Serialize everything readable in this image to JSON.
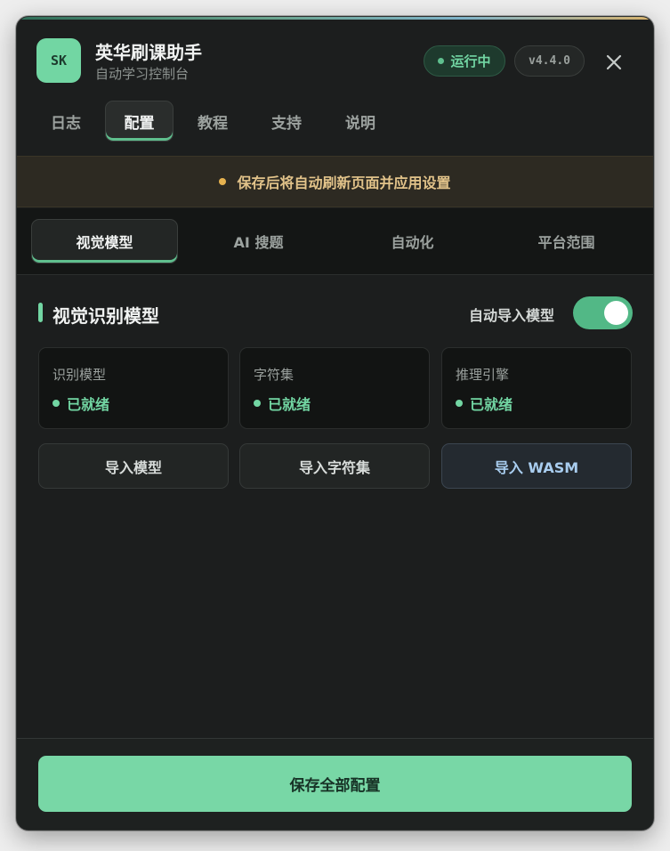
{
  "header": {
    "logo_text": "SK",
    "title": "英华刷课助手",
    "subtitle": "自动学习控制台",
    "status": "运行中",
    "version": "v4.4.0",
    "close_icon": "close-icon"
  },
  "main_tabs": [
    {
      "label": "日志"
    },
    {
      "label": "配置",
      "active": true
    },
    {
      "label": "教程"
    },
    {
      "label": "支持"
    },
    {
      "label": "说明"
    }
  ],
  "banner": {
    "text": "保存后将自动刷新页面并应用设置"
  },
  "sub_tabs": [
    {
      "label": "视觉模型",
      "active": true
    },
    {
      "label": "AI 搜题"
    },
    {
      "label": "自动化"
    },
    {
      "label": "平台范围"
    }
  ],
  "section": {
    "title": "视觉识别模型",
    "toggle_label": "自动导入模型",
    "toggle_on": true
  },
  "cards": [
    {
      "label": "识别模型",
      "status": "已就绪"
    },
    {
      "label": "字符集",
      "status": "已就绪"
    },
    {
      "label": "推理引擎",
      "status": "已就绪"
    }
  ],
  "buttons": {
    "import_model": "导入模型",
    "import_charset": "导入字符集",
    "import_wasm": "导入 WASM",
    "save_all": "保存全部配置"
  },
  "colors": {
    "accent": "#72d6a3",
    "background": "#1c1e1e",
    "banner_text": "#e2c38a",
    "wasm_text": "#a9cdef"
  }
}
